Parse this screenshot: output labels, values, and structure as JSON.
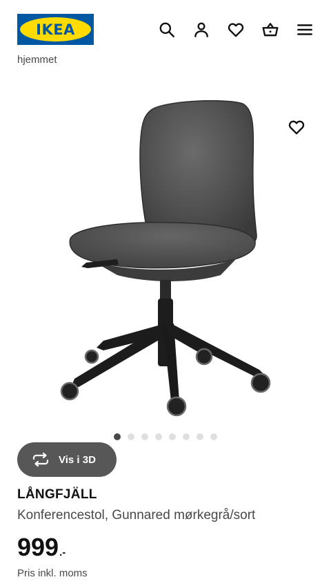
{
  "header": {
    "logo_text": "IKEA",
    "icons": [
      "search-icon",
      "user-icon",
      "heart-icon",
      "basket-icon",
      "menu-icon"
    ]
  },
  "breadcrumb": {
    "fragment": "hjemmet"
  },
  "gallery": {
    "view_3d_label": "Vis i 3D",
    "slide_count": 8,
    "active_slide": 1
  },
  "product": {
    "name": "LÅNGFJÄLL",
    "description": "Konferencestol, Gunnared mørkegrå/sort",
    "price_integer": "999",
    "price_decimal": ".-",
    "price_note": "Pris inkl. moms"
  },
  "colors": {
    "brand_blue": "#0058a3",
    "brand_yellow": "#ffdb00",
    "text_primary": "#111111",
    "text_secondary": "#484848"
  }
}
